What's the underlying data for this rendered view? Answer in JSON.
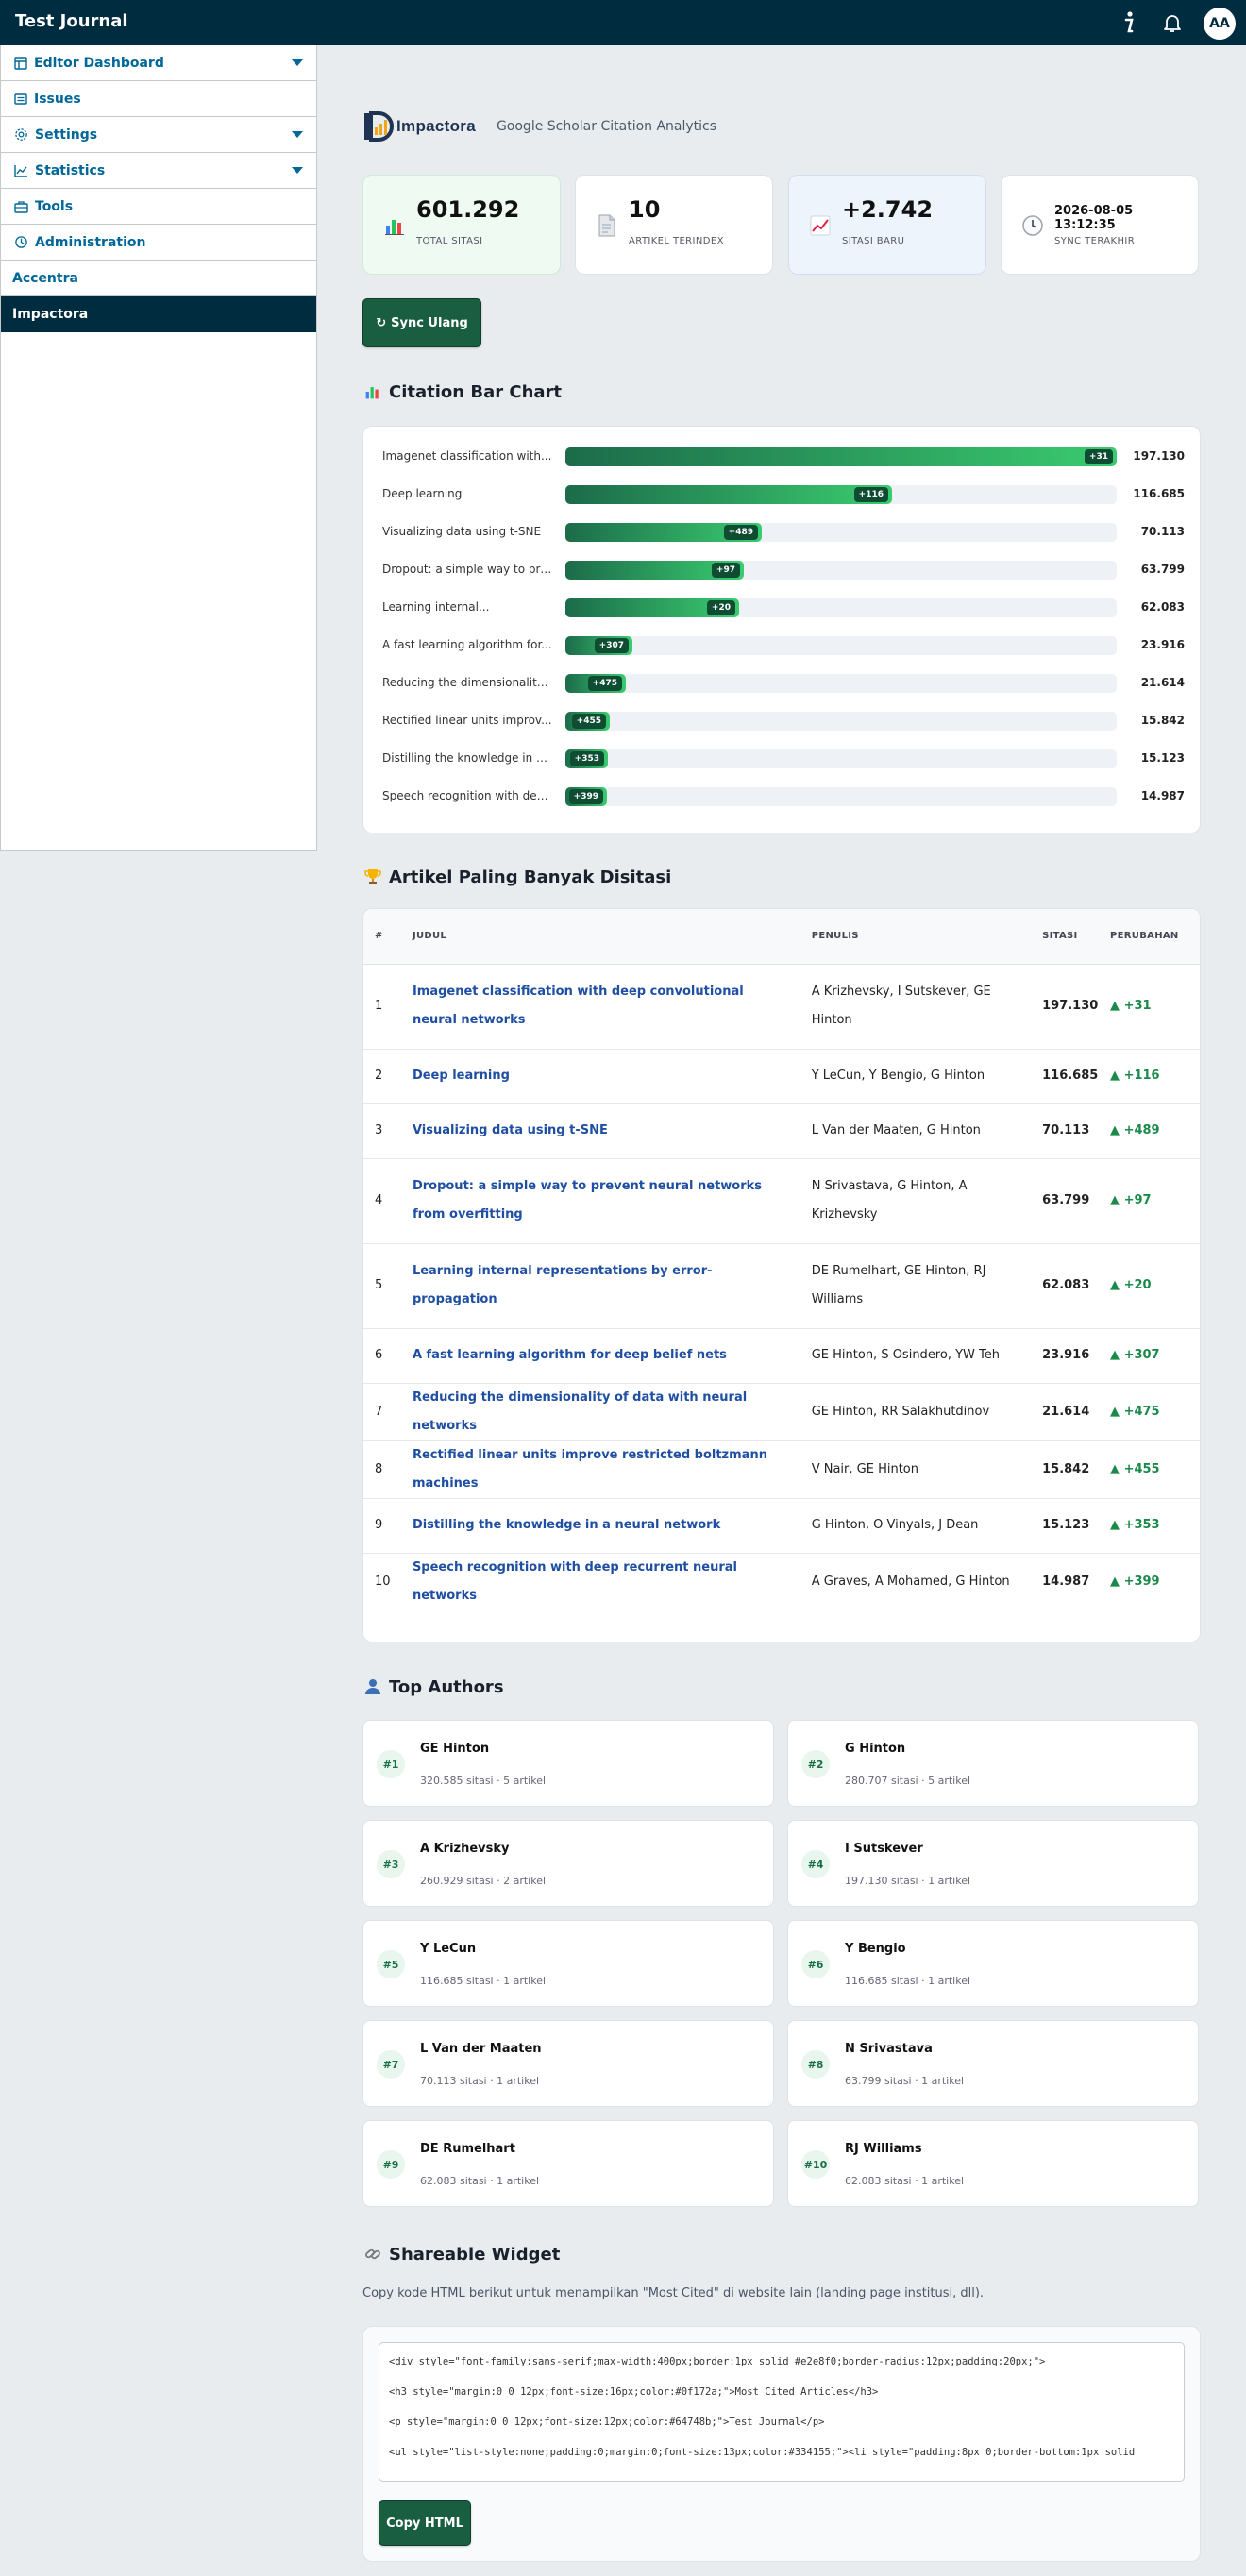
{
  "topbar": {
    "title": "Test Journal",
    "avatar": "AA",
    "icons": [
      "info-icon",
      "bell-icon"
    ]
  },
  "sidebar": {
    "items": [
      {
        "label": "Editor Dashboard",
        "icon": "dashboard-icon",
        "has_submenu": true
      },
      {
        "label": "Issues",
        "icon": "issues-icon",
        "has_submenu": false
      },
      {
        "label": "Settings",
        "icon": "gear-icon",
        "has_submenu": true
      },
      {
        "label": "Statistics",
        "icon": "chart-line-icon",
        "has_submenu": true
      },
      {
        "label": "Tools",
        "icon": "toolbox-icon",
        "has_submenu": false
      },
      {
        "label": "Administration",
        "icon": "administration-icon",
        "has_submenu": false
      },
      {
        "label": "Accentra",
        "icon": "",
        "has_submenu": false
      },
      {
        "label": "Impactora",
        "icon": "",
        "has_submenu": false,
        "active": true
      }
    ]
  },
  "header": {
    "brand": "Impactora",
    "subtitle": "Google Scholar Citation Analytics"
  },
  "stats": [
    {
      "value": "601.292",
      "label": "TOTAL SITASI",
      "icon": "bar-chart-icon",
      "bg": "#effaf3"
    },
    {
      "value": "10",
      "label": "ARTIKEL TERINDEX",
      "icon": "document-icon",
      "bg": "#ffffff"
    },
    {
      "value": "+2.742",
      "label": "SITASI BARU",
      "icon": "trend-up-icon",
      "bg": "#eef4fc"
    },
    {
      "value": "2026-08-05 13:12:35",
      "label": "SYNC TERAKHIR",
      "icon": "clock-icon",
      "bg": "#ffffff"
    }
  ],
  "sync_button": "Sync Ulang",
  "bar_section_title": "Citation Bar Chart",
  "chart_data": {
    "type": "bar",
    "orientation": "horizontal",
    "categories": [
      "Imagenet classification with...",
      "Deep learning",
      "Visualizing data using t-SNE",
      "Dropout: a simple way to pre...",
      "Learning internal...",
      "A fast learning algorithm for...",
      "Reducing the dimensionality...",
      "Rectified linear units improv...",
      "Distilling the knowledge in a...",
      "Speech recognition with dee..."
    ],
    "values": [
      197130,
      116685,
      70113,
      63799,
      62083,
      23916,
      21614,
      15842,
      15123,
      14987
    ],
    "value_labels": [
      "197.130",
      "116.685",
      "70.113",
      "63.799",
      "62.083",
      "23.916",
      "21.614",
      "15.842",
      "15.123",
      "14.987"
    ],
    "deltas": [
      "+31",
      "+116",
      "+489",
      "+97",
      "+20",
      "+307",
      "+475",
      "+455",
      "+353",
      "+399"
    ],
    "max": 197130
  },
  "table_section_title": "Artikel Paling Banyak Disitasi",
  "table": {
    "headers": [
      "#",
      "JUDUL",
      "PENULIS",
      "SITASI",
      "PERUBAHAN"
    ],
    "rows": [
      {
        "n": "1",
        "title": "Imagenet classification with deep convolutional neural networks",
        "authors": "A Krizhevsky, I Sutskever, GE Hinton",
        "cites": "197.130",
        "change": "▲ +31"
      },
      {
        "n": "2",
        "title": "Deep learning",
        "authors": "Y LeCun, Y Bengio, G Hinton",
        "cites": "116.685",
        "change": "▲ +116"
      },
      {
        "n": "3",
        "title": "Visualizing data using t-SNE",
        "authors": "L Van der Maaten, G Hinton",
        "cites": "70.113",
        "change": "▲ +489"
      },
      {
        "n": "4",
        "title": "Dropout: a simple way to prevent neural networks from overfitting",
        "authors": "N Srivastava, G Hinton, A Krizhevsky",
        "cites": "63.799",
        "change": "▲ +97"
      },
      {
        "n": "5",
        "title": "Learning internal representations by error-propagation",
        "authors": "DE Rumelhart, GE Hinton, RJ Williams",
        "cites": "62.083",
        "change": "▲ +20"
      },
      {
        "n": "6",
        "title": "A fast learning algorithm for deep belief nets",
        "authors": "GE Hinton, S Osindero, YW Teh",
        "cites": "23.916",
        "change": "▲ +307"
      },
      {
        "n": "7",
        "title": "Reducing the dimensionality of data with neural networks",
        "authors": "GE Hinton, RR Salakhutdinov",
        "cites": "21.614",
        "change": "▲ +475"
      },
      {
        "n": "8",
        "title": "Rectified linear units improve restricted boltzmann machines",
        "authors": "V Nair, GE Hinton",
        "cites": "15.842",
        "change": "▲ +455"
      },
      {
        "n": "9",
        "title": "Distilling the knowledge in a neural network",
        "authors": "G Hinton, O Vinyals, J Dean",
        "cites": "15.123",
        "change": "▲ +353"
      },
      {
        "n": "10",
        "title": "Speech recognition with deep recurrent neural networks",
        "authors": "A Graves, A Mohamed, G Hinton",
        "cites": "14.987",
        "change": "▲ +399"
      }
    ]
  },
  "authors_section_title": "Top Authors",
  "authors": [
    {
      "rank": "#1",
      "name": "GE Hinton",
      "meta": "320.585 sitasi · 5 artikel"
    },
    {
      "rank": "#2",
      "name": "G Hinton",
      "meta": "280.707 sitasi · 5 artikel"
    },
    {
      "rank": "#3",
      "name": "A Krizhevsky",
      "meta": "260.929 sitasi · 2 artikel"
    },
    {
      "rank": "#4",
      "name": "I Sutskever",
      "meta": "197.130 sitasi · 1 artikel"
    },
    {
      "rank": "#5",
      "name": "Y LeCun",
      "meta": "116.685 sitasi · 1 artikel"
    },
    {
      "rank": "#6",
      "name": "Y Bengio",
      "meta": "116.685 sitasi · 1 artikel"
    },
    {
      "rank": "#7",
      "name": "L Van der Maaten",
      "meta": "70.113 sitasi · 1 artikel"
    },
    {
      "rank": "#8",
      "name": "N Srivastava",
      "meta": "63.799 sitasi · 1 artikel"
    },
    {
      "rank": "#9",
      "name": "DE Rumelhart",
      "meta": "62.083 sitasi · 1 artikel"
    },
    {
      "rank": "#10",
      "name": "RJ Williams",
      "meta": "62.083 sitasi · 1 artikel"
    }
  ],
  "widget": {
    "title": "Shareable Widget",
    "description": "Copy kode HTML berikut untuk menampilkan \"Most Cited\" di website lain (landing page institusi, dll).",
    "code_lines": [
      "<div style=\"font-family:sans-serif;max-width:400px;border:1px solid #e2e8f0;border-radius:12px;padding:20px;\">",
      "<h3 style=\"margin:0 0 12px;font-size:16px;color:#0f172a;\">Most Cited Articles</h3>",
      "<p style=\"margin:0 0 12px;font-size:12px;color:#64748b;\">Test Journal</p>",
      "<ul style=\"list-style:none;padding:0;margin:0;font-size:13px;color:#334155;\"><li style=\"padding:8px 0;border-bottom:1px solid"
    ],
    "copy_button": "Copy HTML"
  }
}
